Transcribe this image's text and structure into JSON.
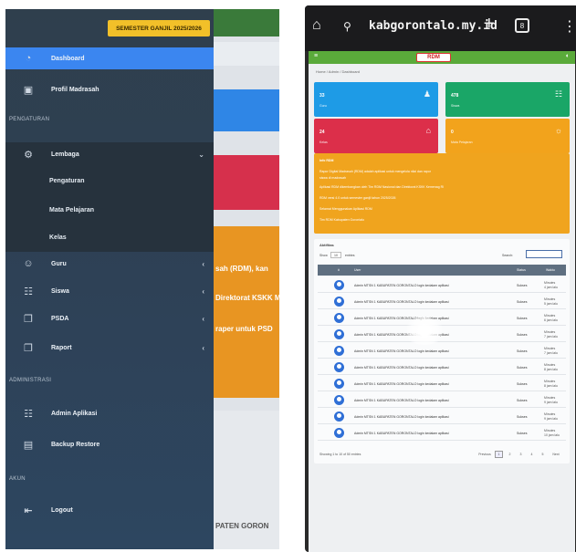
{
  "left": {
    "semester_badge": "SEMESTER GANJIL 2025/2026",
    "nav": {
      "dashboard": "Dashboard",
      "profil": "Profil Madrasah",
      "section_pengaturan": "PENGATURAN",
      "lembaga": "Lembaga",
      "sub_items": [
        "Pengaturan",
        "Mata Pelajaran",
        "Kelas"
      ],
      "guru": "Guru",
      "siswa": "Siswa",
      "psda": "PSDA",
      "raport": "Raport",
      "section_administrasi": "ADMINISTRASI",
      "admin_aplikasi": "Admin Aplikasi",
      "backup_restore": "Backup Restore",
      "section_akun": "AKUN",
      "logout": "Logout"
    },
    "background_fragments": [
      "sah (RDM), kan",
      "Direktorat KSKK M",
      "raper untuk PSD",
      "PATEN GORON"
    ]
  },
  "right": {
    "url": "kabgorontalo.my.id",
    "tab_count": "8",
    "app_logo": "RDM",
    "breadcrumb": "Home / Admin / Dashboard",
    "cards": [
      {
        "value": "33",
        "label": "Guru",
        "color": "#1e9be6"
      },
      {
        "value": "478",
        "label": "Siswa",
        "color": "#1aa667"
      },
      {
        "value": "24",
        "label": "Kelas",
        "color": "#dc2f4a"
      },
      {
        "value": "0",
        "label": "Mata Pelajaran",
        "color": "#f2a31c"
      }
    ],
    "info_lines": [
      "Info RDM",
      "Rapor Digital Madrasah (RDM) adalah aplikasi untuk mengelola nilai dan rapor",
      "siswa di madrasah",
      "Aplikasi RDM dikembangkan oleh Tim RDM Nasional dan Direktorat KSKK Kemenag RI",
      "RDM versi 4.0 untuk semester ganjil tahun 2025/2026",
      "Selamat Menggunakan Aplikasi RDM",
      "Tim RDM Kabupaten Gorontalo"
    ],
    "table": {
      "title": "Aktifitas",
      "show_label": "Show",
      "show_value": "10",
      "entries_label": "entries",
      "search_label": "Search:",
      "headers": [
        "#",
        "User",
        "Status",
        "Waktu"
      ],
      "rows": [
        {
          "text": "Admin MTSN 1 KABUPATEN GORONTALO login kedalam aplikasi",
          "status": "Sukses",
          "time1": "Minutes",
          "time2": "4 jam lalu"
        },
        {
          "text": "Admin MTSN 1 KABUPATEN GORONTALO login kedalam aplikasi",
          "status": "Sukses",
          "time1": "Minutes",
          "time2": "5 jam lalu"
        },
        {
          "text": "Admin MTSN 1 KABUPATEN GORONTALO login kedalam aplikasi",
          "status": "Sukses",
          "time1": "Minutes",
          "time2": "6 jam lalu"
        },
        {
          "text": "Admin MTSN 1 KABUPATEN GORONTALO login kedalam aplikasi",
          "status": "Sukses",
          "time1": "Minutes",
          "time2": "7 jam lalu"
        },
        {
          "text": "Admin MTSN 1 KABUPATEN GORONTALO login kedalam aplikasi",
          "status": "Sukses",
          "time1": "Minutes",
          "time2": "7 jam lalu"
        },
        {
          "text": "Admin MTSN 1 KABUPATEN GORONTALO login kedalam aplikasi",
          "status": "Sukses",
          "time1": "Minutes",
          "time2": "8 jam lalu"
        },
        {
          "text": "Admin MTSN 1 KABUPATEN GORONTALO login kedalam aplikasi",
          "status": "Sukses",
          "time1": "Minutes",
          "time2": "8 jam lalu"
        },
        {
          "text": "Admin MTSN 1 KABUPATEN GORONTALO login kedalam aplikasi",
          "status": "Sukses",
          "time1": "Minutes",
          "time2": "9 jam lalu"
        },
        {
          "text": "Admin MTSN 1 KABUPATEN GORONTALO login kedalam aplikasi",
          "status": "Sukses",
          "time1": "Minutes",
          "time2": "9 jam lalu"
        },
        {
          "text": "Admin MTSN 1 KABUPATEN GORONTALO login kedalam aplikasi",
          "status": "Sukses",
          "time1": "Minutes",
          "time2": "10 jam lalu"
        }
      ],
      "footer_info": "Showing 1 to 10 of 50 entries",
      "pagination": [
        "Previous",
        "1",
        "2",
        "3",
        "4",
        "5",
        "Next"
      ]
    }
  }
}
